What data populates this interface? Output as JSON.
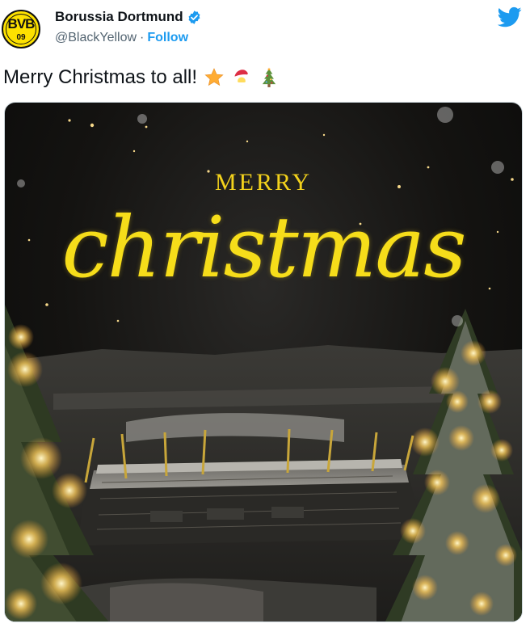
{
  "account": {
    "display_name": "Borussia Dortmund",
    "handle": "@BlackYellow",
    "separator": "·",
    "follow_label": "Follow",
    "avatar_letters": "BVB",
    "avatar_sub": "09",
    "brand_color": "#FDE100"
  },
  "icons": {
    "verified": "verified-badge-icon",
    "platform": "twitter-bird-icon"
  },
  "tweet": {
    "text": "Merry Christmas to all!",
    "emojis": [
      "star",
      "santa",
      "christmas-tree"
    ]
  },
  "media": {
    "headline_small": "MERRY",
    "headline_script": "christmas",
    "text_color": "#F6DD1A"
  }
}
